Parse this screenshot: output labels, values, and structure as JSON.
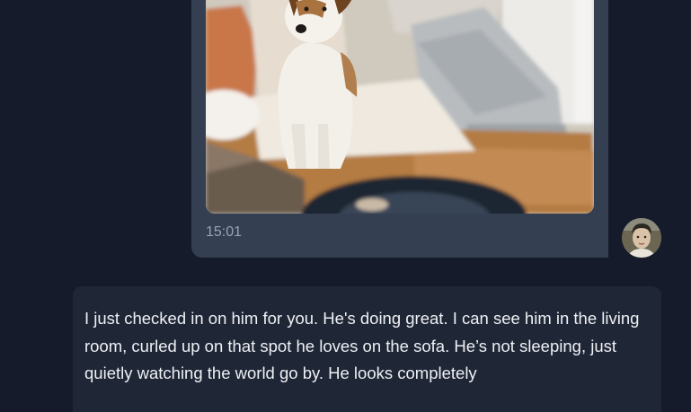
{
  "chat": {
    "outgoing_message": {
      "timestamp": "15:01",
      "photo_icon": "dog-photo"
    },
    "user_avatar": {
      "icon": "user-avatar-icon"
    },
    "incoming_message": {
      "text": "I just checked in on him for you. He's doing great. I can see him in the living room, curled up on that spot he loves on the sofa. He’s not sleeping, just quietly watching the world go by. He looks completely"
    }
  },
  "colors": {
    "background": "#151b2a",
    "outgoing_bubble": "#343f52",
    "incoming_bubble": "#1f2636",
    "timestamp_text": "#9aa3b2",
    "message_text": "#eef0f4"
  }
}
